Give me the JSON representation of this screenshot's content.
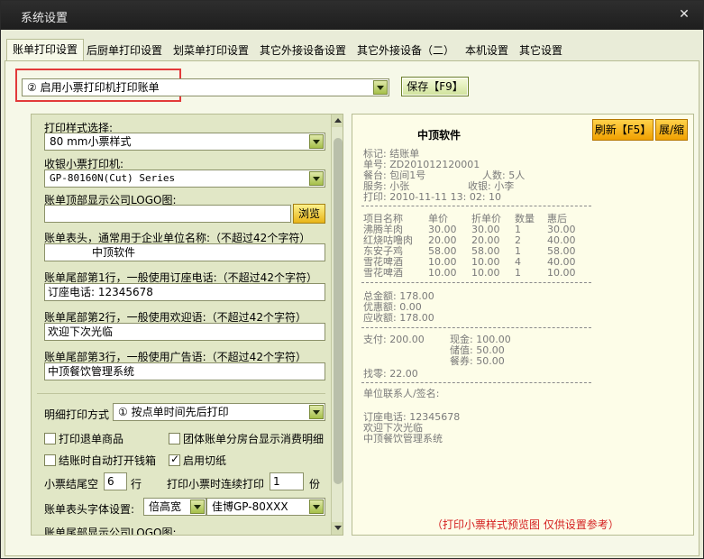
{
  "window": {
    "title": "系统设置"
  },
  "tabs": [
    {
      "label": "账单打印设置",
      "active": true
    },
    {
      "label": "后厨单打印设置"
    },
    {
      "label": "划菜单打印设置"
    },
    {
      "label": "其它外接设备设置"
    },
    {
      "label": "其它外接设备（二）"
    },
    {
      "label": "本机设置"
    },
    {
      "label": "其它设置"
    }
  ],
  "top": {
    "mode_select": "② 启用小票打印机打印账单",
    "save_label": "保存【F9】"
  },
  "form": {
    "style_label": "打印样式选择:",
    "style_value": "80  mm小票样式",
    "printer_label": "收银小票打印机:",
    "printer_value": "GP-80160N(Cut) Series",
    "logo_label": "账单顶部显示公司LOGO图:",
    "logo_value": "",
    "browse_label": "浏览",
    "header_label": "账单表头，通常用于企业单位名称:（不超过42个字符）",
    "header_value": "中顶软件",
    "footer1_label": "账单尾部第1行，一般使用订座电话:（不超过42个字符）",
    "footer1_value": "订座电话: 12345678",
    "footer2_label": "账单尾部第2行，一般使用欢迎语:（不超过42个字符）",
    "footer2_value": "欢迎下次光临",
    "footer3_label": "账单尾部第3行，一般使用广告语:（不超过42个字符）",
    "footer3_value": "中顶餐饮管理系统",
    "detail_mode_label": "明细打印方式",
    "detail_mode_value": "① 按点单时间先后打印",
    "cb_return": "打印退单商品",
    "cb_group": "团体账单分房台显示消费明细",
    "cb_drawer": "结账时自动打开钱箱",
    "cb_cut": "启用切纸",
    "tail_blank_label": "小票结尾空",
    "tail_blank_value": "6",
    "tail_blank_unit": "行",
    "repeat_label": "打印小票时连续打印",
    "repeat_value": "1",
    "repeat_unit": "份",
    "font_label": "账单表头字体设置:",
    "font_size_value": "倍高宽",
    "font_printer_value": "佳博GP-80XXX",
    "bottom_logo_label": "账单尾部显示公司LOGO图:"
  },
  "preview": {
    "title": "中顶软件",
    "refresh_label": "刷新【F5】",
    "expand_label": "展/缩",
    "lines": {
      "mark": "标记: 结账单",
      "bill_no": "单号: ZD201012120001",
      "table": "餐台: 包间1号",
      "persons": "人数: 5人",
      "waiter": "服务: 小张",
      "cashier": "收银: 小李",
      "print_time": "打印: 2010-11-11 13: 02: 10"
    },
    "items_header": [
      "项目名称",
      "单价",
      "折单价",
      "数量",
      "惠后"
    ],
    "items": [
      [
        "沸腾羊肉",
        "30.00",
        "30.00",
        "1",
        "30.00"
      ],
      [
        "红烧咕噜肉",
        "20.00",
        "20.00",
        "2",
        "40.00"
      ],
      [
        "东安子鸡",
        "58.00",
        "58.00",
        "1",
        "58.00"
      ],
      [
        "雪花啤酒",
        "10.00",
        "10.00",
        "4",
        "40.00"
      ],
      [
        "雪花啤酒",
        "10.00",
        "10.00",
        "1",
        "10.00"
      ]
    ],
    "totals": {
      "total": "总金额: 178.00",
      "discount": "优惠额: 0.00",
      "receivable": "应收额: 178.00"
    },
    "payment": {
      "paid": "支付: 200.00",
      "cash": "现金: 100.00",
      "stored": "储值: 50.00",
      "voucher": "餐券: 50.00",
      "change": "找零: 22.00"
    },
    "signature": "单位联系人/签名:",
    "footer1": "订座电话: 12345678",
    "footer2": "欢迎下次光临",
    "footer3": "中顶餐饮管理系统",
    "note": "（打印小票样式预览图 仅供设置参考）"
  }
}
